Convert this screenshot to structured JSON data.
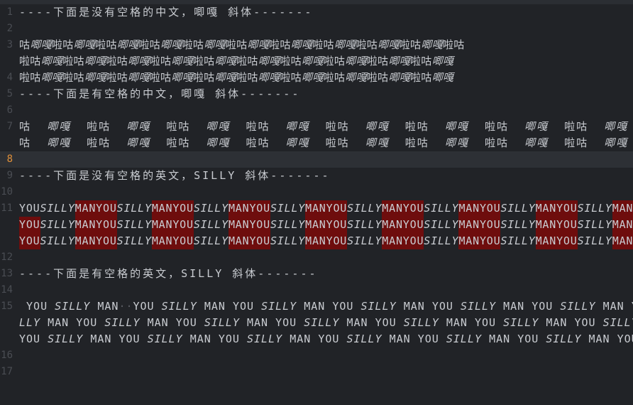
{
  "editor": {
    "line_numbers": [
      "1",
      "2",
      "3",
      "",
      "",
      "4",
      "5",
      "6",
      "7",
      "",
      "8",
      "9",
      "10",
      "11",
      "",
      "",
      "12",
      "13",
      "14",
      "15",
      "",
      "",
      "16",
      "17"
    ],
    "current_line": "8",
    "line1": "----下面是没有空格的中文，唧嘎 斜体-------",
    "line5": "----下面是有空格的中文，唧嘎 斜体-------",
    "line9": "----下面是没有空格的英文，SILLY 斜体-------",
    "line13": "----下面是有空格的英文，SILLY 斜体-------",
    "word_gu": "咕",
    "word_jiga": "唧嘎",
    "word_lagu": "啦咕",
    "word_la": "啦",
    "word_you": "YOU",
    "word_silly": "SILLY",
    "word_man": "MAN",
    "word_lly": "LLY",
    "visible_space_marker": "··",
    "line15_wrap2_tail": "Y"
  }
}
